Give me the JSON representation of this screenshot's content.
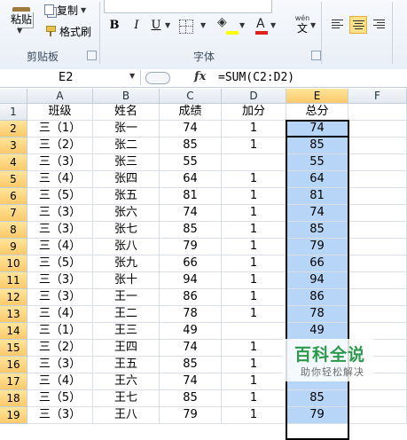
{
  "ribbon": {
    "paste_label": "粘贴",
    "copy_label": "复制",
    "format_painter_label": "格式刷",
    "clipboard_group_label": "剪贴板",
    "font_group_label": "字体",
    "bold": "B",
    "italic": "I",
    "underline": "U",
    "font_color_letter": "A",
    "phonetic_label": "wén",
    "phonetic_char": "文",
    "accent_fill_color": "#ffff00",
    "accent_font_color": "#e0201b"
  },
  "formula_bar": {
    "name_box": "E2",
    "fx_label": "fx",
    "formula": "=SUM(C2:D2)"
  },
  "sheet": {
    "columns": [
      "A",
      "B",
      "C",
      "D",
      "E",
      "F"
    ],
    "selected_column": "E",
    "header_row": {
      "row": "1",
      "cells": [
        "班级",
        "姓名",
        "成绩",
        "加分",
        "总分",
        ""
      ]
    },
    "rows": [
      {
        "row": "2",
        "cells": [
          "三（1）",
          "张一",
          "74",
          "1",
          "74",
          ""
        ]
      },
      {
        "row": "3",
        "cells": [
          "三（2）",
          "张二",
          "85",
          "1",
          "85",
          ""
        ]
      },
      {
        "row": "4",
        "cells": [
          "三（3）",
          "张三",
          "55",
          "",
          "55",
          ""
        ]
      },
      {
        "row": "5",
        "cells": [
          "三（4）",
          "张四",
          "64",
          "1",
          "64",
          ""
        ]
      },
      {
        "row": "6",
        "cells": [
          "三（5）",
          "张五",
          "81",
          "1",
          "81",
          ""
        ]
      },
      {
        "row": "7",
        "cells": [
          "三（3）",
          "张六",
          "74",
          "1",
          "74",
          ""
        ]
      },
      {
        "row": "8",
        "cells": [
          "三（3）",
          "张七",
          "85",
          "1",
          "85",
          ""
        ]
      },
      {
        "row": "9",
        "cells": [
          "三（4）",
          "张八",
          "79",
          "1",
          "79",
          ""
        ]
      },
      {
        "row": "10",
        "cells": [
          "三（5）",
          "张九",
          "66",
          "1",
          "66",
          ""
        ]
      },
      {
        "row": "11",
        "cells": [
          "三（3）",
          "张十",
          "94",
          "1",
          "94",
          ""
        ]
      },
      {
        "row": "12",
        "cells": [
          "三（3）",
          "王一",
          "86",
          "1",
          "86",
          ""
        ]
      },
      {
        "row": "13",
        "cells": [
          "三（4）",
          "王二",
          "78",
          "1",
          "78",
          ""
        ]
      },
      {
        "row": "14",
        "cells": [
          "三（1）",
          "王三",
          "49",
          "",
          "49",
          ""
        ]
      },
      {
        "row": "15",
        "cells": [
          "三（2）",
          "王四",
          "74",
          "1",
          "",
          ""
        ]
      },
      {
        "row": "16",
        "cells": [
          "三（3）",
          "王五",
          "85",
          "1",
          "",
          ""
        ]
      },
      {
        "row": "17",
        "cells": [
          "三（4）",
          "王六",
          "74",
          "1",
          "",
          ""
        ]
      },
      {
        "row": "18",
        "cells": [
          "三（5）",
          "王七",
          "85",
          "1",
          "85",
          ""
        ]
      },
      {
        "row": "19",
        "cells": [
          "三（3）",
          "王八",
          "79",
          "1",
          "79",
          ""
        ]
      }
    ]
  },
  "watermark": {
    "title": "百科全说",
    "subtitle": "助你轻松解决"
  }
}
